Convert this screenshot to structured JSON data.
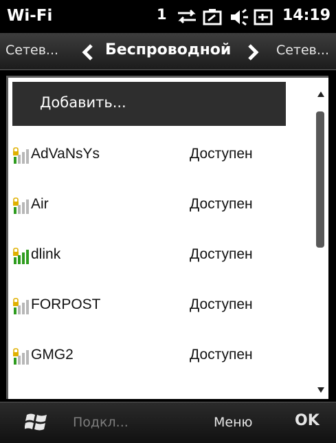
{
  "status_bar": {
    "title": "Wi-Fi",
    "indicator": "1",
    "icons": [
      "connectivity-icon",
      "battery-icon",
      "volume-icon",
      "power-icon"
    ],
    "time": "14:19"
  },
  "nav": {
    "prev_label": "Сетев...",
    "current_label": "Беспроводной",
    "next_label": "Сетев..."
  },
  "list": {
    "add_label": "Добавить...",
    "networks": [
      {
        "name": "AdVaNsYs",
        "status": "Доступен",
        "signal_bars": 1
      },
      {
        "name": "Air",
        "status": "Доступен",
        "signal_bars": 1
      },
      {
        "name": "dlink",
        "status": "Доступен",
        "signal_bars": 4
      },
      {
        "name": "FORPOST",
        "status": "Доступен",
        "signal_bars": 1
      },
      {
        "name": "GMG2",
        "status": "Доступен",
        "signal_bars": 1
      }
    ]
  },
  "menu_bar": {
    "left_softkey": "Подкл...",
    "menu_label": "Меню",
    "ok_label": "OK"
  },
  "colors": {
    "signal_on": "#2f9c1f",
    "signal_off": "#b7b7b7",
    "lock": "#e0b000"
  }
}
